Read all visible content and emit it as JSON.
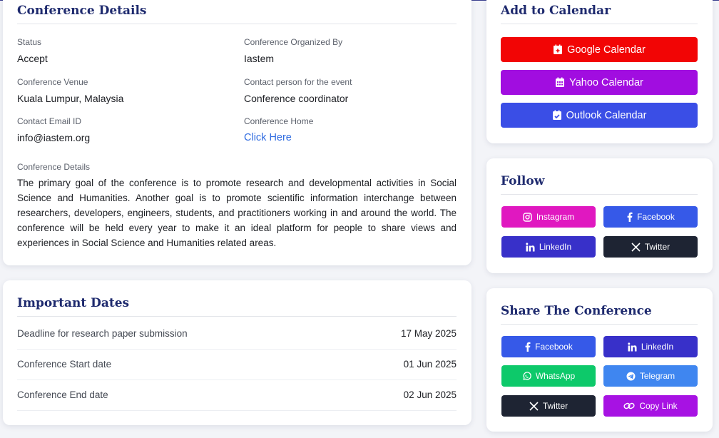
{
  "details": {
    "title": "Conference Details",
    "fields": [
      {
        "label": "Status",
        "value": "Accept"
      },
      {
        "label": "Conference Organized By",
        "value": "Iastem"
      },
      {
        "label": "Conference Venue",
        "value": "Kuala Lumpur, Malaysia"
      },
      {
        "label": "Contact person for the event",
        "value": "Conference coordinator"
      },
      {
        "label": "Contact Email ID",
        "value": "info@iastem.org"
      },
      {
        "label": "Conference Home",
        "value": "Click Here"
      }
    ],
    "description_label": "Conference Details",
    "description": "The primary goal of the conference is to promote research and developmental activities in Social Science and Humanities. Another goal is to promote scientific information interchange between researchers, developers, engineers, students, and practitioners working in and around the world. The conference will be held every year to make it an ideal platform for people to share views and experiences in Social Science and Humanities related areas."
  },
  "dates": {
    "title": "Important Dates",
    "rows": [
      {
        "label": "Deadline for research paper submission",
        "date": "17 May 2025"
      },
      {
        "label": "Conference Start date",
        "date": "01 Jun 2025"
      },
      {
        "label": "Conference End date",
        "date": "02 Jun 2025"
      }
    ]
  },
  "calendar": {
    "title": "Add to Calendar",
    "google": "Google Calendar",
    "yahoo": "Yahoo Calendar",
    "outlook": "Outlook Calendar"
  },
  "follow": {
    "title": "Follow",
    "instagram": "Instagram",
    "facebook": "Facebook",
    "linkedin": "LinkedIn",
    "twitter": "Twitter"
  },
  "share": {
    "title": "Share The Conference",
    "facebook": "Facebook",
    "linkedin": "LinkedIn",
    "whatsapp": "WhatsApp",
    "telegram": "Telegram",
    "twitter": "Twitter",
    "copy_link": "Copy Link"
  },
  "colors": {
    "google": "#f20505",
    "yahoo": "#a10de0",
    "outlook": "#3a4ee6",
    "instagram": "#e018c0",
    "facebook": "#3659e8",
    "linkedin": "#3830c9",
    "twitter": "#1e2433",
    "whatsapp": "#0dc96a",
    "telegram": "#3f86f0",
    "copy_link": "#a712e3",
    "title": "#1e2a6e",
    "link": "#2f6be0"
  },
  "icons": {
    "google": "calendar-plus-icon",
    "yahoo": "calendar-grid-icon",
    "outlook": "calendar-check-icon",
    "instagram": "instagram-icon",
    "facebook": "facebook-icon",
    "linkedin": "linkedin-icon",
    "twitter": "x-twitter-icon",
    "whatsapp": "whatsapp-icon",
    "telegram": "telegram-icon",
    "copy_link": "link-icon"
  }
}
